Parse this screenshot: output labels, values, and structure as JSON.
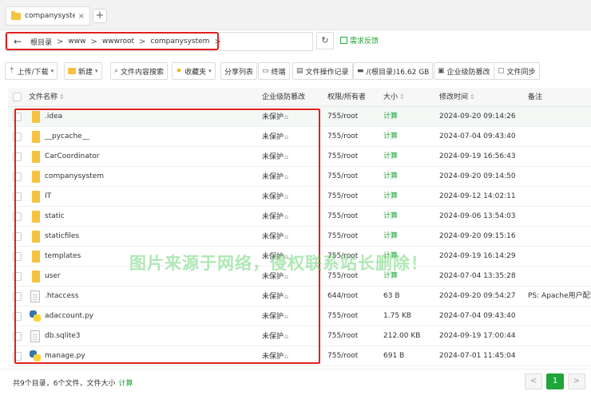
{
  "tab": {
    "label": "companysystem",
    "close": "×",
    "add": "+"
  },
  "address": {
    "back": "←",
    "crumbs": [
      "根目录",
      "www",
      "wwwroot",
      "companysystem"
    ],
    "sep": ">",
    "refresh": "↻",
    "feedback": "需求反馈"
  },
  "toolbar": {
    "upload": "上传/下载",
    "new": "新建",
    "search": "文件内容搜索",
    "favorites": "收藏夹",
    "share": "分享列表",
    "terminal": "终端",
    "oplog": "文件操作记录",
    "disk": "/(根目录)16.62 GB",
    "protect": "企业级防篡改",
    "sync": "文件同步"
  },
  "columns": {
    "name": "文件名称",
    "protect": "企业级防篡改",
    "perm": "权限/所有者",
    "size": "大小",
    "mtime": "修改时间",
    "note": "备注"
  },
  "rows": [
    {
      "type": "folder",
      "name": ".idea",
      "protect": "未保护",
      "perm": "755/root",
      "size": "计算",
      "size_calc": true,
      "mtime": "2024-09-20 09:14:26",
      "note": ""
    },
    {
      "type": "folder",
      "name": "__pycache__",
      "protect": "未保护",
      "perm": "755/root",
      "size": "计算",
      "size_calc": true,
      "mtime": "2024-07-04 09:43:40",
      "note": ""
    },
    {
      "type": "folder",
      "name": "CarCoordinator",
      "protect": "未保护",
      "perm": "755/root",
      "size": "计算",
      "size_calc": true,
      "mtime": "2024-09-19 16:56:43",
      "note": ""
    },
    {
      "type": "folder",
      "name": "companysystem",
      "protect": "未保护",
      "perm": "755/root",
      "size": "计算",
      "size_calc": true,
      "mtime": "2024-09-20 09:14:50",
      "note": ""
    },
    {
      "type": "folder",
      "name": "IT",
      "protect": "未保护",
      "perm": "755/root",
      "size": "计算",
      "size_calc": true,
      "mtime": "2024-09-12 14:02:11",
      "note": ""
    },
    {
      "type": "folder",
      "name": "static",
      "protect": "未保护",
      "perm": "755/root",
      "size": "计算",
      "size_calc": true,
      "mtime": "2024-09-06 13:54:03",
      "note": ""
    },
    {
      "type": "folder",
      "name": "staticfiles",
      "protect": "未保护",
      "perm": "755/root",
      "size": "计算",
      "size_calc": true,
      "mtime": "2024-09-20 09:15:16",
      "note": ""
    },
    {
      "type": "folder",
      "name": "templates",
      "protect": "未保护",
      "perm": "755/root",
      "size": "计算",
      "size_calc": true,
      "mtime": "2024-09-19 16:14:29",
      "note": ""
    },
    {
      "type": "folder",
      "name": "user",
      "protect": "未保护",
      "perm": "755/root",
      "size": "计算",
      "size_calc": true,
      "mtime": "2024-07-04 13:35:28",
      "note": ""
    },
    {
      "type": "doc",
      "name": ".htaccess",
      "protect": "未保护",
      "perm": "644/root",
      "size": "63 B",
      "size_calc": false,
      "mtime": "2024-09-20 09:54:27",
      "note": "PS: Apache用户配置"
    },
    {
      "type": "py",
      "name": "adaccount.py",
      "protect": "未保护",
      "perm": "755/root",
      "size": "1.75 KB",
      "size_calc": false,
      "mtime": "2024-07-04 09:43:40",
      "note": ""
    },
    {
      "type": "doc",
      "name": "db.sqlite3",
      "protect": "未保护",
      "perm": "755/root",
      "size": "212.00 KB",
      "size_calc": false,
      "mtime": "2024-09-19 17:00:44",
      "note": ""
    },
    {
      "type": "py",
      "name": "manage.py",
      "protect": "未保护",
      "perm": "755/root",
      "size": "691 B",
      "size_calc": false,
      "mtime": "2024-07-01 11:45:04",
      "note": ""
    }
  ],
  "footer": {
    "summary": "共9个目录，6个文件，文件大小",
    "calc": "计算",
    "prev": "<",
    "page": "1",
    "next": ">"
  },
  "watermark": "图片来源于网络，侵权联系站长删除！",
  "colors": {
    "accent": "#20a53a",
    "highlight": "#e02020",
    "folder": "#f5c242"
  }
}
